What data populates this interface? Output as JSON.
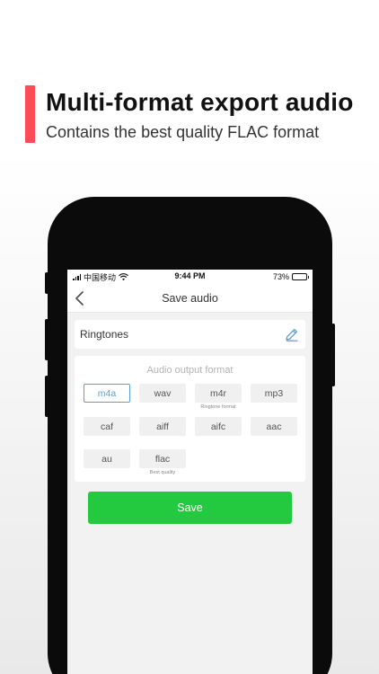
{
  "promo": {
    "title": "Multi-format export audio",
    "subtitle": "Contains the best quality FLAC format",
    "accent_color": "#ff4a57"
  },
  "status_bar": {
    "carrier": "中国移动",
    "time": "9:44 PM",
    "battery": "73%",
    "battery_level": 0.73
  },
  "nav": {
    "title": "Save audio",
    "back_icon": "chevron-left-icon"
  },
  "file_name": {
    "value": "Ringtones",
    "edit_icon": "pencil-icon"
  },
  "formats": {
    "heading": "Audio output format",
    "selected": "m4a",
    "items": [
      {
        "label": "m4a",
        "note": ""
      },
      {
        "label": "wav",
        "note": ""
      },
      {
        "label": "m4r",
        "note": "Ringtone format"
      },
      {
        "label": "mp3",
        "note": ""
      },
      {
        "label": "caf",
        "note": ""
      },
      {
        "label": "aiff",
        "note": ""
      },
      {
        "label": "aifc",
        "note": ""
      },
      {
        "label": "aac",
        "note": ""
      },
      {
        "label": "au",
        "note": ""
      },
      {
        "label": "flac",
        "note": "Best quality"
      }
    ]
  },
  "save": {
    "label": "Save",
    "color": "#23c93e"
  }
}
